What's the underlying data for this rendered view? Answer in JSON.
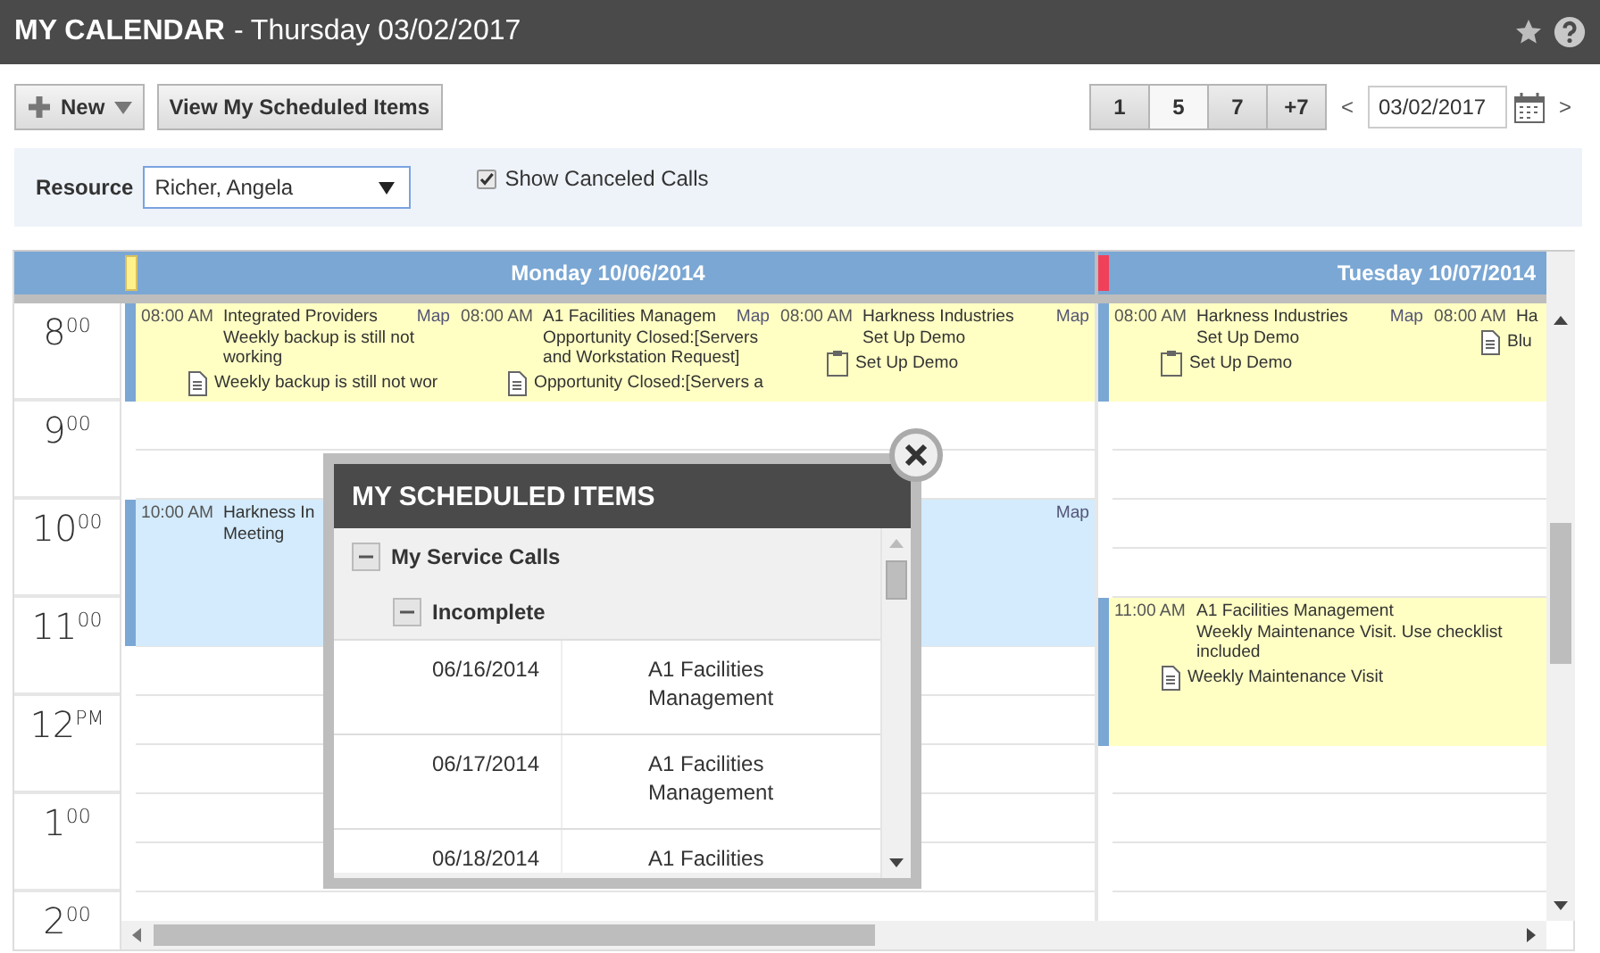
{
  "window": {
    "title": "MY CALENDAR",
    "subtitle": "- Thursday 03/02/2017"
  },
  "toolbar": {
    "new_button": "New",
    "scheduled_button": "View My Scheduled Items",
    "views": [
      {
        "label": "1",
        "selected": false
      },
      {
        "label": "5",
        "selected": true
      },
      {
        "label": "7",
        "selected": false
      },
      {
        "label": "+7",
        "selected": false
      }
    ],
    "prev": "<",
    "date": "03/02/2017",
    "next": ">"
  },
  "filter": {
    "resource_label": "Resource",
    "resource": "Richer, Angela",
    "show_canceled": {
      "label": "Show Canceled Calls",
      "checked": true
    }
  },
  "calendar": {
    "hours": [
      "8$^{00}$",
      "9$^{00}$",
      "10$^{00}$",
      "11$^{00}$",
      "12$^{PM}$",
      "1$^{00}$",
      "2$^{00}$"
    ],
    "days": [
      {
        "label": "Monday 10/06/2014",
        "color": "#fff28c",
        "events": [
          {
            "color": "#ffffc4",
            "time": "08:00 AM",
            "title": "Integrated Providers",
            "map": "Map",
            "description": "Weekly backup is still not working",
            "item": {
              "kind": "note",
              "text": "Weekly backup is still not wor"
            }
          },
          {
            "color": "#ffffc4",
            "time": "08:00 AM",
            "title": "A1 Facilities Managem",
            "map": "Map",
            "description": "Opportunity Closed:[Servers and Workstation Request]",
            "item": {
              "kind": "note",
              "text": "Opportunity Closed:[Servers a"
            }
          },
          {
            "color": "#ffffc4",
            "time": "08:00 AM",
            "title": "Harkness Industries",
            "map": "Map",
            "description": "Set Up Demo",
            "item": {
              "kind": "task",
              "text": "Set Up Demo"
            }
          },
          {
            "color": "#d3ebfc",
            "time": "10:00 AM",
            "title": "Harkness In",
            "map": "Map",
            "description": "Meeting"
          }
        ]
      },
      {
        "label": "Tuesday 10/07/2014",
        "color": "#f0405a",
        "events": [
          {
            "color": "#ffffc4",
            "time": "08:00 AM",
            "title": "Harkness Industries",
            "map": "Map",
            "description": "Set Up Demo",
            "item": {
              "kind": "task",
              "text": "Set Up Demo"
            }
          },
          {
            "color": "#ffffc4",
            "time": "08:00 AM",
            "title": "Ha",
            "item": {
              "kind": "note",
              "text": "Blu"
            }
          },
          {
            "color": "#ffffc4",
            "time": "11:00 AM",
            "title": "A1 Facilities Management",
            "description": "Weekly Maintenance Visit. Use checklist included",
            "item": {
              "kind": "note",
              "text": "Weekly Maintenance Visit"
            }
          }
        ]
      }
    ]
  },
  "popup": {
    "title": "MY SCHEDULED ITEMS",
    "tree": [
      {
        "label": "My Service Calls",
        "expanded": true,
        "children": [
          {
            "label": "Incomplete",
            "expanded": true,
            "rows": [
              {
                "date": "06/16/2014",
                "company": "A1 Facilities Management"
              },
              {
                "date": "06/17/2014",
                "company": "A1 Facilities Management"
              },
              {
                "date": "06/18/2014",
                "company": "A1 Facilities"
              }
            ]
          }
        ]
      }
    ]
  }
}
